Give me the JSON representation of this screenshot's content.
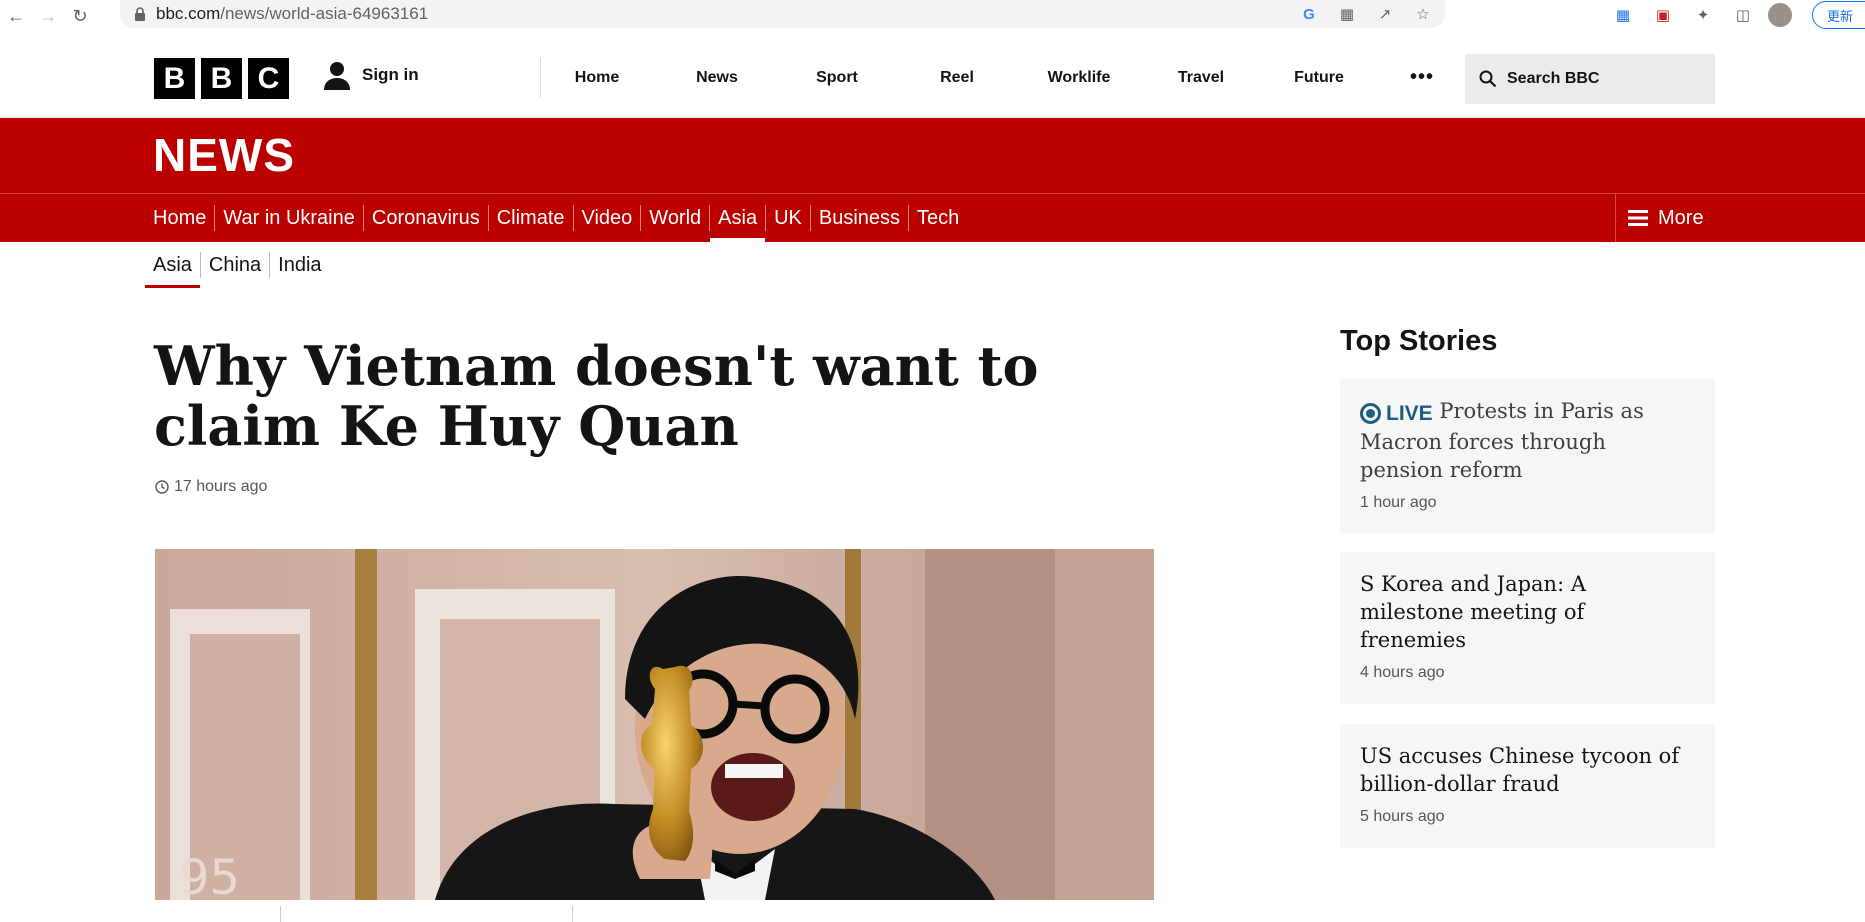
{
  "browser": {
    "url_domain": "bbc.com",
    "url_path": "/news/world-asia-64963161",
    "update_label": "更新"
  },
  "global_nav": {
    "logo_letters": [
      "B",
      "B",
      "C"
    ],
    "signin_label": "Sign in",
    "items": [
      "Home",
      "News",
      "Sport",
      "Reel",
      "Worklife",
      "Travel",
      "Future"
    ],
    "more_label": "•••",
    "search_label": "Search BBC"
  },
  "news": {
    "title": "NEWS",
    "nav": [
      "Home",
      "War in Ukraine",
      "Coronavirus",
      "Climate",
      "Video",
      "World",
      "Asia",
      "UK",
      "Business",
      "Tech"
    ],
    "active": "Asia",
    "more_label": "More"
  },
  "sub_nav": {
    "items": [
      "Asia",
      "China",
      "India"
    ],
    "active": "Asia"
  },
  "article": {
    "headline": "Why Vietnam doesn't want to claim Ke Huy Quan",
    "timestamp": "17 hours ago"
  },
  "top_stories": {
    "heading": "Top Stories",
    "stories": [
      {
        "live": "LIVE",
        "title": "Protests in Paris as Macron forces through pension reform",
        "time": "1 hour ago"
      },
      {
        "title": "S Korea and Japan: A milestone meeting of frenemies",
        "time": "4 hours ago"
      },
      {
        "title": "US accuses Chinese tycoon of billion-dollar fraud",
        "time": "5 hours ago"
      }
    ]
  },
  "colors": {
    "bbc_red": "#bb0000",
    "live_blue": "#1b5e7e"
  }
}
